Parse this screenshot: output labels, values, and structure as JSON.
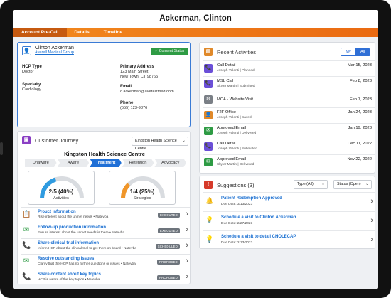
{
  "header": {
    "title": "Ackerman, Clinton"
  },
  "tabs": [
    "Account Pre-Call",
    "Details",
    "Timeline"
  ],
  "hcp": {
    "name": "Clinton Ackerman",
    "org": "Averell Medical Group",
    "consent_label": "Consent Status",
    "hcp_type_label": "HCP Type",
    "hcp_type": "Doctor",
    "specialty_label": "Specialty",
    "specialty": "Cardiology",
    "address_label": "Primary Address",
    "address_line1": "123 Main Street",
    "address_line2": "New Town, CT 98765",
    "email_label": "Email",
    "email": "c.ackerman@averelltmed.com",
    "phone_label": "Phone",
    "phone": "(555) 123-9876"
  },
  "journey": {
    "title": "Customer Journey",
    "select": "Kingston Health Science Centre",
    "org_title": "Kingston Health Science Centre",
    "stages": [
      "Unaware",
      "Aware",
      "Treatment",
      "Retention",
      "Advocacy"
    ],
    "gauges": [
      {
        "value": "2/5 (40%)",
        "label": "Activities",
        "fraction": 0.4,
        "color": "#2f9be0"
      },
      {
        "value": "1/4 (25%)",
        "label": "Strategies",
        "fraction": 0.25,
        "color": "#f0962a"
      }
    ],
    "tasks": [
      {
        "title": "Prouct Information",
        "desc": "Rise interest about the unmet needs • Natevba",
        "status": "EXECUTED",
        "icon": "📋"
      },
      {
        "title": "Follow-up production information",
        "desc": "Ensure interest about the unmet needs is there • Natevba",
        "status": "EXECUTED",
        "icon": "✉"
      },
      {
        "title": "Share clinical trial information",
        "desc": "Inform HCP about the clinical trial to get them on board • Natevba",
        "status": "SCHEDULED",
        "icon": "📞"
      },
      {
        "title": "Resolve outstanding issues",
        "desc": "Clarify that the HCP has no further questions or issues • Natevba",
        "status": "PROPOSED",
        "icon": "✉"
      },
      {
        "title": "Share content about key topics",
        "desc": "HCP is aware of the key topics • Natevba",
        "status": "PROPOSED",
        "icon": "📞"
      }
    ]
  },
  "activities": {
    "title": "Recent Activities",
    "toggle": [
      "My",
      "All"
    ],
    "items": [
      {
        "title": "Call Detail",
        "sub": "Joseph Valenti | Planned",
        "date": "Mar 15, 2023",
        "icon": "📞",
        "color": "#6b4fd8"
      },
      {
        "title": "MSL Call",
        "sub": "Skyler Martin | Submitted",
        "date": "Feb 8, 2023",
        "icon": "📞",
        "color": "#6b4fd8"
      },
      {
        "title": "MCA - Website Visit",
        "sub": "",
        "date": "Feb 7, 2023",
        "icon": "⚙",
        "color": "#7a7f86"
      },
      {
        "title": "F2F Office",
        "sub": "Joseph Valenti | Saved",
        "date": "Jan 24, 2023",
        "icon": "👤",
        "color": "#e0892a"
      },
      {
        "title": "Approved Email",
        "sub": "Joseph Valenti | Delivered",
        "date": "Jan 19, 2023",
        "icon": "✉",
        "color": "#2e9b44"
      },
      {
        "title": "Call Detail",
        "sub": "Joseph Valenti | Submitted",
        "date": "Dec 11, 2022",
        "icon": "📞",
        "color": "#6b4fd8"
      },
      {
        "title": "Approved Email",
        "sub": "Skyler Martin | Delivered",
        "date": "Nov 22, 2022",
        "icon": "✉",
        "color": "#2e9b44"
      }
    ]
  },
  "suggestions": {
    "title": "Suggestions (3)",
    "type_select": "Type (All)",
    "status_select": "Status (Open)",
    "items": [
      {
        "title": "Patient Redemption Approved",
        "date": "Due Date: 3/13/2023",
        "icon": "🔔",
        "color": "#d63a2a"
      },
      {
        "title": "Schedule a visit to Clinton Ackerman",
        "date": "Due Date: 2/27/2023",
        "icon": "💡",
        "color": "#2f8be0"
      },
      {
        "title": "Schedule a visit to detail CHOLECAP",
        "date": "Due Date: 2/13/2023",
        "icon": "💡",
        "color": "#2f8be0"
      }
    ]
  }
}
